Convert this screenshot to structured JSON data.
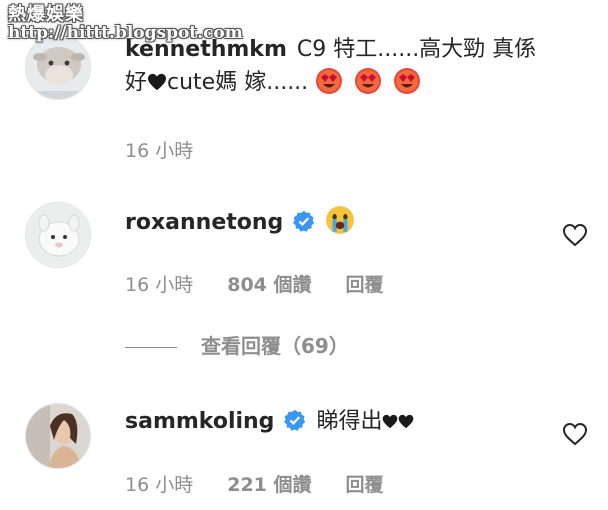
{
  "watermark": {
    "title": "熱爆娛樂",
    "url": "http://hittt.blogspot.com"
  },
  "comments": [
    {
      "username": "kennethmkm",
      "text_line1": "C9 特工......高大勁 真係",
      "text_line2_prefix": "好",
      "text_line2_mid": "cute媽 嫁......",
      "time": "16 小時",
      "avatar_icon": "sheep-plush-icon"
    },
    {
      "username": "roxannetong",
      "verified": true,
      "time": "16 小時",
      "likes": "804 個讚",
      "reply": "回覆",
      "view_replies": "查看回覆（69）",
      "avatar_icon": "white-plush-icon"
    },
    {
      "username": "sammkoling",
      "verified": true,
      "text": "睇得出",
      "time": "16 小時",
      "likes": "221 個讚",
      "reply": "回覆",
      "avatar_icon": "portrait-avatar-icon"
    }
  ],
  "colors": {
    "verified_blue": "#3897f0",
    "text": "#262626",
    "secondary": "#8e8e8e"
  }
}
